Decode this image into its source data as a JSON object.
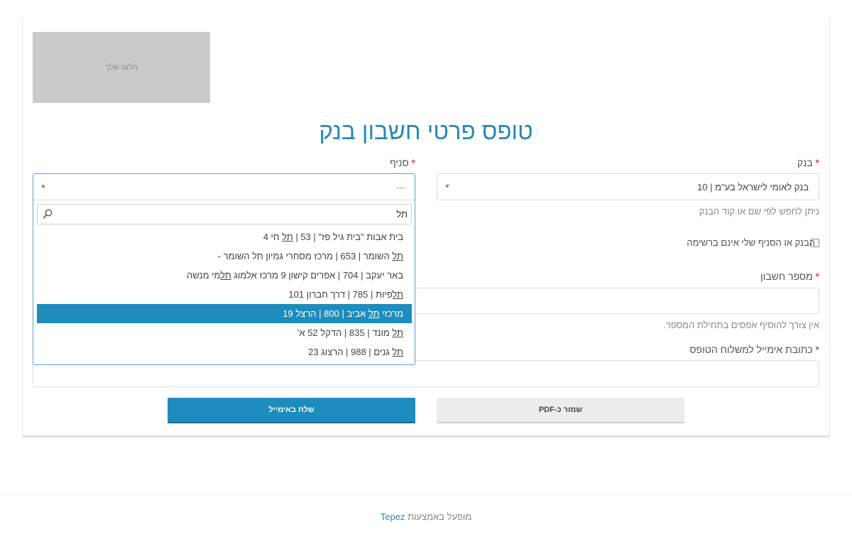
{
  "logo": {
    "text": "הלוגו שלך"
  },
  "form": {
    "title": "טופס פרטי חשבון בנק",
    "required_mark": "*",
    "bank": {
      "label": "בנק",
      "value": "בנק לאומי לישראל בע\"מ | 10",
      "help": "ניתן לחפש לפי שם או קוד הבנק"
    },
    "branch": {
      "label": "סניף",
      "placeholder": "---",
      "search_value": "תל",
      "options": [
        {
          "pre": "בית אבות \"בית גיל פז\" | 53 | ",
          "hit": "תל",
          "post": " חי 4"
        },
        {
          "pre": "",
          "hit": "תל",
          "post": " השומר | 653 | מרכז מסחרי גמיון תל השומר -"
        },
        {
          "pre": "באר יעקב | 704 | אפרים קישון 9 מרכז אלמוג ",
          "hit": "תל",
          "post": "מי מנשה"
        },
        {
          "pre": "",
          "hit": "תל",
          "post": "פיות | 785 | דרך חברון 101"
        },
        {
          "pre": "מרכזי ",
          "hit": "תל",
          "post": " אביב | 800 | הרצל 19"
        },
        {
          "pre": "",
          "hit": "תל",
          "post": " מונד | 835 | הדקל 52 א'"
        },
        {
          "pre": "",
          "hit": "תל",
          "post": " גנים | 988 | הרצוג 23"
        }
      ],
      "selected_index": 4
    },
    "not_listed": {
      "label": "הבנק או הסניף שלי אינם ברשימה",
      "checked": false
    },
    "account": {
      "label": "מספר חשבון",
      "value": "",
      "help": "אין צורך להוסיף אפסים בתחילת המספר."
    },
    "email": {
      "label": "כתובת אימייל למשלוח הטופס",
      "value": ""
    },
    "buttons": {
      "save_pdf": "שמור כ-PDF",
      "send_email": "שלח באימייל"
    }
  },
  "footer": {
    "prefix": "מופעל באמצעות",
    "brand": "Tepez"
  },
  "colors": {
    "accent": "#1e8cbc",
    "title": "#2589b7",
    "required": "#d9534f"
  }
}
